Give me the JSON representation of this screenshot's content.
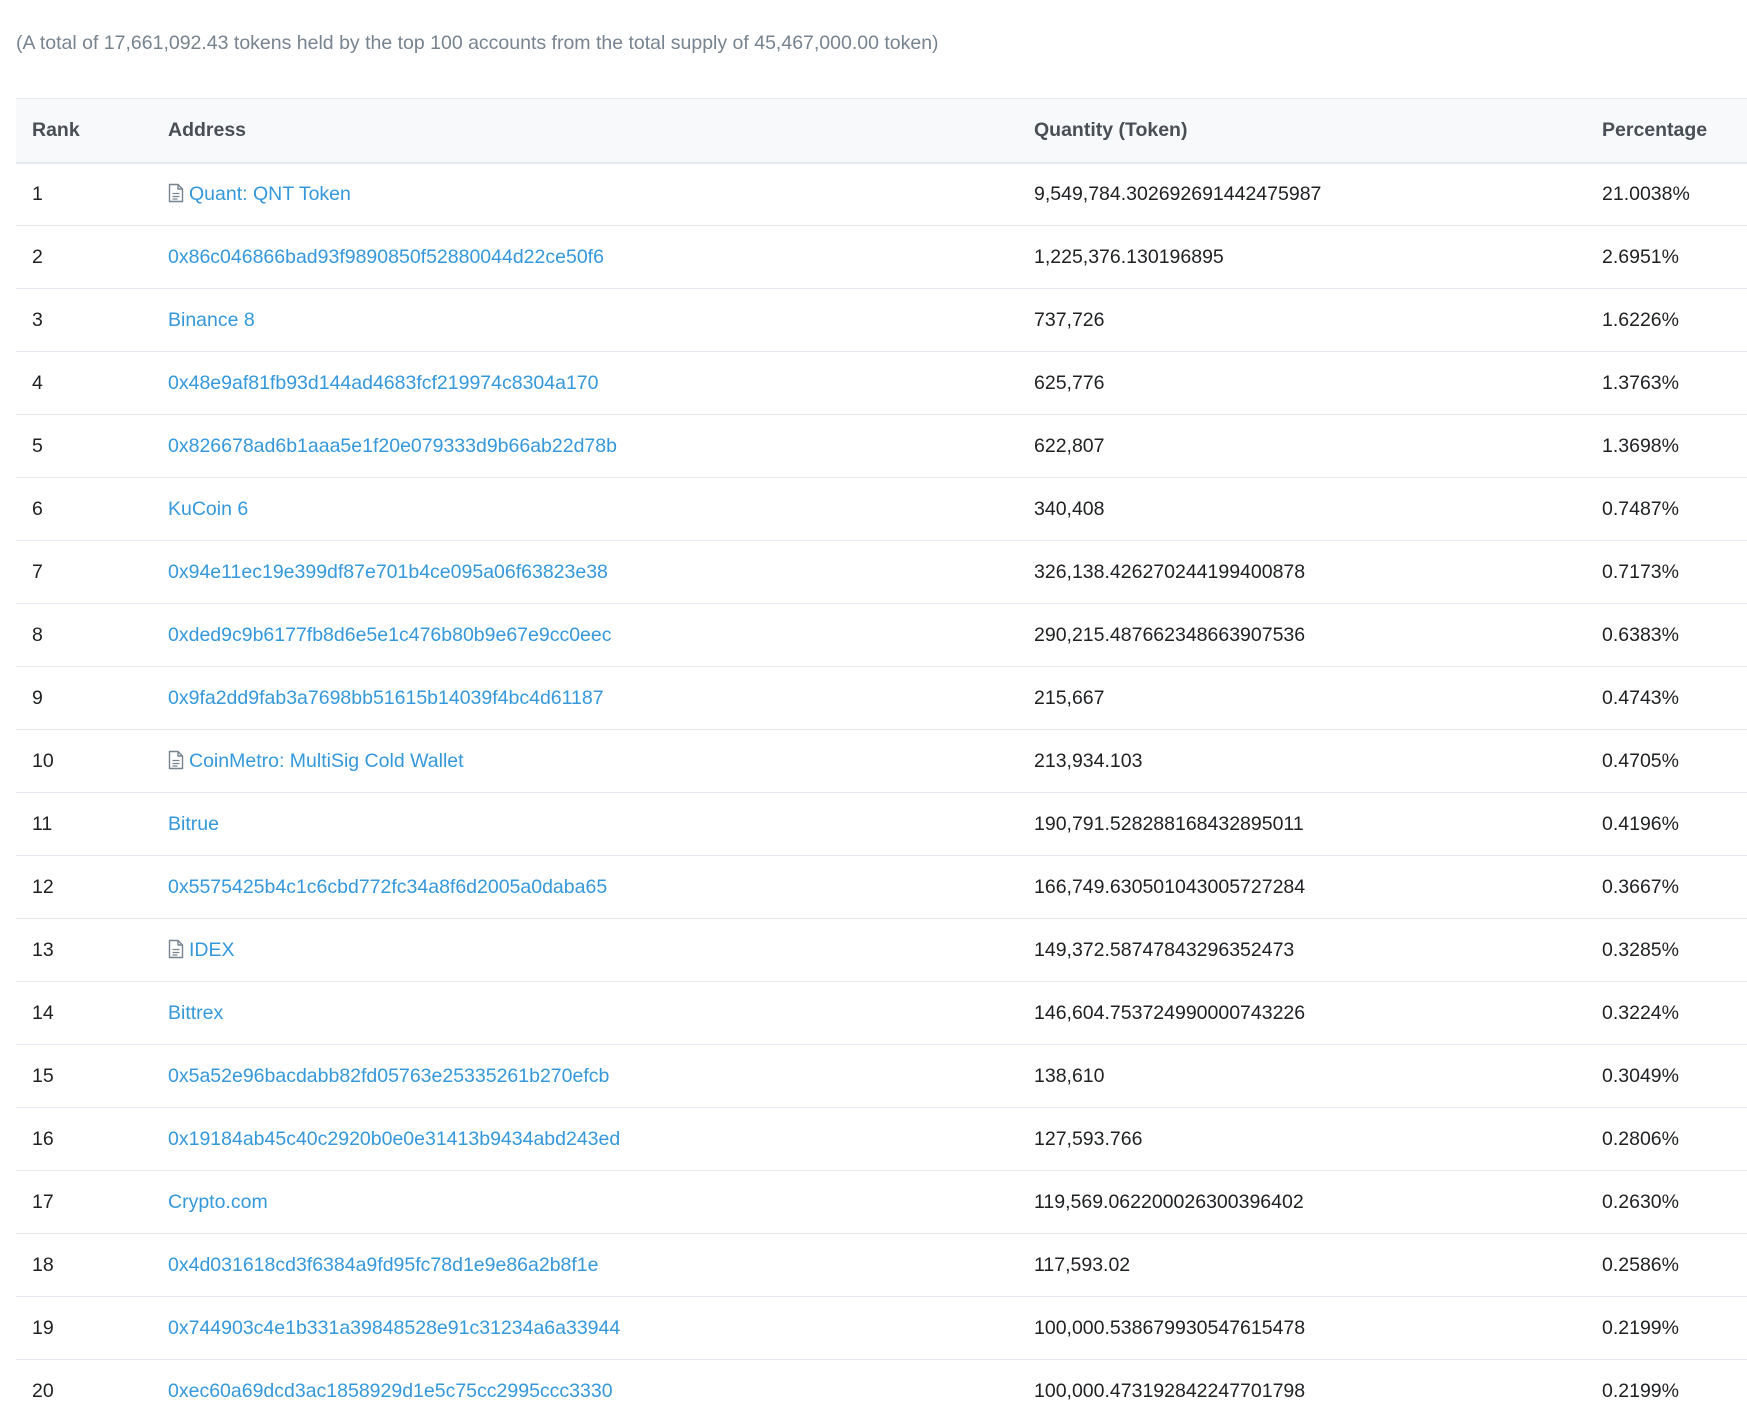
{
  "summary": "(A total of 17,661,092.43 tokens held by the top 100 accounts from the total supply of 45,467,000.00 token)",
  "columns": {
    "rank": "Rank",
    "address": "Address",
    "quantity": "Quantity (Token)",
    "percentage": "Percentage"
  },
  "colors": {
    "link": "#3498db",
    "header_bg": "#f8f9fa",
    "muted_text": "#77838f"
  },
  "rows": [
    {
      "rank": "1",
      "address": "Quant: QNT Token",
      "is_contract": true,
      "quantity": "9,549,784.302692691442475987",
      "percentage": "21.0038%"
    },
    {
      "rank": "2",
      "address": "0x86c046866bad93f9890850f52880044d22ce50f6",
      "is_contract": false,
      "quantity": "1,225,376.130196895",
      "percentage": "2.6951%"
    },
    {
      "rank": "3",
      "address": "Binance 8",
      "is_contract": false,
      "quantity": "737,726",
      "percentage": "1.6226%"
    },
    {
      "rank": "4",
      "address": "0x48e9af81fb93d144ad4683fcf219974c8304a170",
      "is_contract": false,
      "quantity": "625,776",
      "percentage": "1.3763%"
    },
    {
      "rank": "5",
      "address": "0x826678ad6b1aaa5e1f20e079333d9b66ab22d78b",
      "is_contract": false,
      "quantity": "622,807",
      "percentage": "1.3698%"
    },
    {
      "rank": "6",
      "address": "KuCoin 6",
      "is_contract": false,
      "quantity": "340,408",
      "percentage": "0.7487%"
    },
    {
      "rank": "7",
      "address": "0x94e11ec19e399df87e701b4ce095a06f63823e38",
      "is_contract": false,
      "quantity": "326,138.426270244199400878",
      "percentage": "0.7173%"
    },
    {
      "rank": "8",
      "address": "0xded9c9b6177fb8d6e5e1c476b80b9e67e9cc0eec",
      "is_contract": false,
      "quantity": "290,215.487662348663907536",
      "percentage": "0.6383%"
    },
    {
      "rank": "9",
      "address": "0x9fa2dd9fab3a7698bb51615b14039f4bc4d61187",
      "is_contract": false,
      "quantity": "215,667",
      "percentage": "0.4743%"
    },
    {
      "rank": "10",
      "address": "CoinMetro: MultiSig Cold Wallet",
      "is_contract": true,
      "quantity": "213,934.103",
      "percentage": "0.4705%"
    },
    {
      "rank": "11",
      "address": "Bitrue",
      "is_contract": false,
      "quantity": "190,791.528288168432895011",
      "percentage": "0.4196%"
    },
    {
      "rank": "12",
      "address": "0x5575425b4c1c6cbd772fc34a8f6d2005a0daba65",
      "is_contract": false,
      "quantity": "166,749.630501043005727284",
      "percentage": "0.3667%"
    },
    {
      "rank": "13",
      "address": "IDEX",
      "is_contract": true,
      "quantity": "149,372.58747843296352473",
      "percentage": "0.3285%"
    },
    {
      "rank": "14",
      "address": "Bittrex",
      "is_contract": false,
      "quantity": "146,604.753724990000743226",
      "percentage": "0.3224%"
    },
    {
      "rank": "15",
      "address": "0x5a52e96bacdabb82fd05763e25335261b270efcb",
      "is_contract": false,
      "quantity": "138,610",
      "percentage": "0.3049%"
    },
    {
      "rank": "16",
      "address": "0x19184ab45c40c2920b0e0e31413b9434abd243ed",
      "is_contract": false,
      "quantity": "127,593.766",
      "percentage": "0.2806%"
    },
    {
      "rank": "17",
      "address": "Crypto.com",
      "is_contract": false,
      "quantity": "119,569.062200026300396402",
      "percentage": "0.2630%"
    },
    {
      "rank": "18",
      "address": "0x4d031618cd3f6384a9fd95fc78d1e9e86a2b8f1e",
      "is_contract": false,
      "quantity": "117,593.02",
      "percentage": "0.2586%"
    },
    {
      "rank": "19",
      "address": "0x744903c4e1b331a39848528e91c31234a6a33944",
      "is_contract": false,
      "quantity": "100,000.538679930547615478",
      "percentage": "0.2199%"
    },
    {
      "rank": "20",
      "address": "0xec60a69dcd3ac1858929d1e5c75cc2995ccc3330",
      "is_contract": false,
      "quantity": "100,000.473192842247701798",
      "percentage": "0.2199%"
    }
  ]
}
